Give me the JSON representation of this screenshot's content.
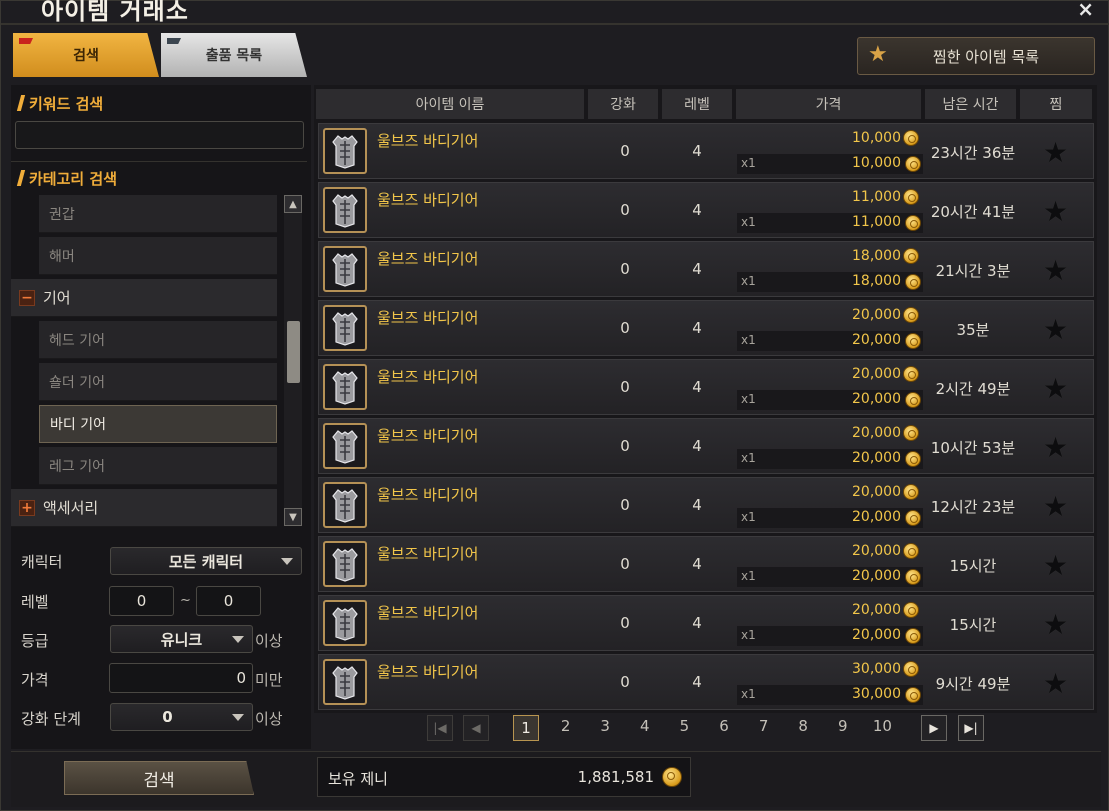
{
  "window": {
    "title": "아이템 거래소",
    "close": "×"
  },
  "tabs": [
    {
      "label": "검색",
      "active": true
    },
    {
      "label": "출품 목록",
      "active": false
    }
  ],
  "favorites_button": {
    "label": "찜한 아이템 목록",
    "icon": "star-icon"
  },
  "left": {
    "keyword_title": "키워드 검색",
    "keyword_value": "",
    "category_title": "카테고리 검색",
    "categories": [
      {
        "label": "권갑",
        "type": "sub"
      },
      {
        "label": "해머",
        "type": "sub"
      },
      {
        "label": "기어",
        "type": "group",
        "toggle": "−"
      },
      {
        "label": "헤드 기어",
        "type": "sub"
      },
      {
        "label": "숄더 기어",
        "type": "sub"
      },
      {
        "label": "바디 기어",
        "type": "sub",
        "selected": true
      },
      {
        "label": "레그 기어",
        "type": "sub"
      },
      {
        "label": "액세서리",
        "type": "group",
        "toggle": "+"
      }
    ],
    "filters": {
      "character_label": "캐릭터",
      "character_value": "모든 캐릭터",
      "level_label": "레벨",
      "level_min": "0",
      "level_sep": "~",
      "level_max": "0",
      "grade_label": "등급",
      "grade_value": "유니크",
      "grade_suffix": "이상",
      "price_label": "가격",
      "price_value": "0",
      "price_suffix": "미만",
      "enhance_label": "강화 단계",
      "enhance_value": "0",
      "enhance_suffix": "이상"
    },
    "search_button": "검색"
  },
  "table": {
    "headers": [
      "아이템 이름",
      "강화",
      "레벨",
      "가격",
      "남은 시간",
      "찜"
    ],
    "rows": [
      {
        "name": "울브즈 바디기어",
        "enhance": "0",
        "level": "4",
        "price": "10,000",
        "qty": "x1",
        "total": "10,000",
        "time": "23시간 36분"
      },
      {
        "name": "울브즈 바디기어",
        "enhance": "0",
        "level": "4",
        "price": "11,000",
        "qty": "x1",
        "total": "11,000",
        "time": "20시간 41분"
      },
      {
        "name": "울브즈 바디기어",
        "enhance": "0",
        "level": "4",
        "price": "18,000",
        "qty": "x1",
        "total": "18,000",
        "time": "21시간 3분"
      },
      {
        "name": "울브즈 바디기어",
        "enhance": "0",
        "level": "4",
        "price": "20,000",
        "qty": "x1",
        "total": "20,000",
        "time": "35분"
      },
      {
        "name": "울브즈 바디기어",
        "enhance": "0",
        "level": "4",
        "price": "20,000",
        "qty": "x1",
        "total": "20,000",
        "time": "2시간 49분"
      },
      {
        "name": "울브즈 바디기어",
        "enhance": "0",
        "level": "4",
        "price": "20,000",
        "qty": "x1",
        "total": "20,000",
        "time": "10시간 53분"
      },
      {
        "name": "울브즈 바디기어",
        "enhance": "0",
        "level": "4",
        "price": "20,000",
        "qty": "x1",
        "total": "20,000",
        "time": "12시간 23분"
      },
      {
        "name": "울브즈 바디기어",
        "enhance": "0",
        "level": "4",
        "price": "20,000",
        "qty": "x1",
        "total": "20,000",
        "time": "15시간"
      },
      {
        "name": "울브즈 바디기어",
        "enhance": "0",
        "level": "4",
        "price": "20,000",
        "qty": "x1",
        "total": "20,000",
        "time": "15시간"
      },
      {
        "name": "울브즈 바디기어",
        "enhance": "0",
        "level": "4",
        "price": "30,000",
        "qty": "x1",
        "total": "30,000",
        "time": "9시간 49분"
      }
    ]
  },
  "pagination": {
    "pages": [
      "1",
      "2",
      "3",
      "4",
      "5",
      "6",
      "7",
      "8",
      "9",
      "10"
    ],
    "current": "1"
  },
  "footer": {
    "zeny_label": "보유 제니",
    "zeny_value": "1,881,581"
  }
}
